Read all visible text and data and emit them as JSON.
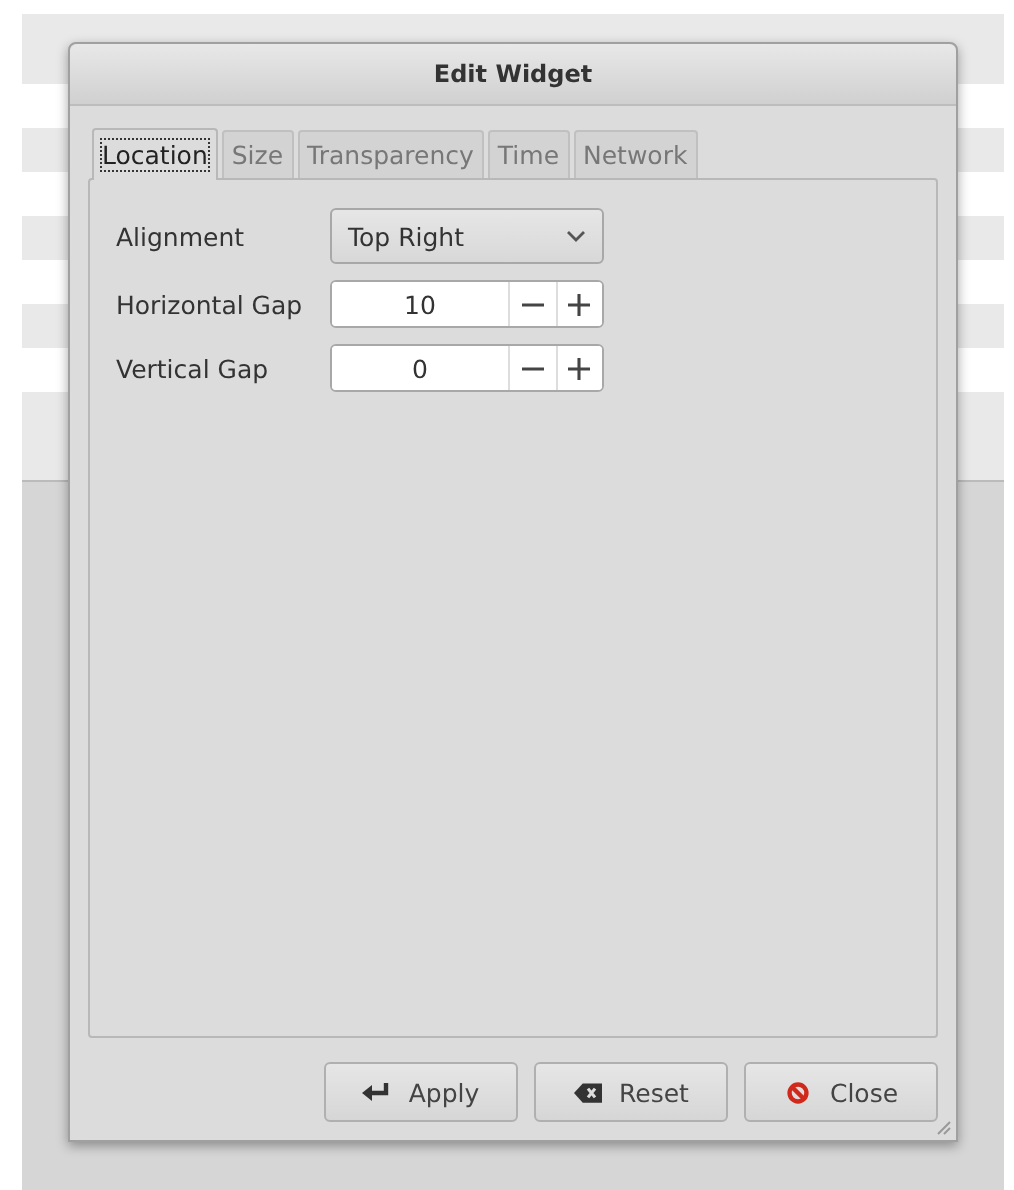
{
  "window": {
    "title": "Edit Widget"
  },
  "tabs": [
    {
      "label": "Location",
      "selected": true
    },
    {
      "label": "Size",
      "selected": false
    },
    {
      "label": "Transparency",
      "selected": false
    },
    {
      "label": "Time",
      "selected": false
    },
    {
      "label": "Network",
      "selected": false
    }
  ],
  "fields": [
    {
      "kind": "dropdown",
      "label": "Alignment",
      "value": "Top Right"
    },
    {
      "kind": "spin",
      "label": "Horizontal Gap",
      "value": "10"
    },
    {
      "kind": "spin",
      "label": "Vertical Gap",
      "value": "0"
    }
  ],
  "buttons": [
    {
      "kind": "apply",
      "label": "Apply"
    },
    {
      "kind": "reset",
      "label": "Reset"
    },
    {
      "kind": "close",
      "label": "Close"
    }
  ]
}
